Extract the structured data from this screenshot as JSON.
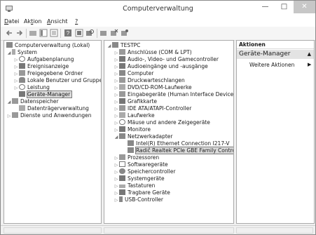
{
  "window": {
    "title": "Computerverwaltung",
    "min_glyph": "—",
    "max_glyph": "□",
    "close_glyph": "✕"
  },
  "menu": {
    "datei": "atei",
    "datei_key": "D",
    "aktion_pre": "Ak",
    "aktion_key": "t",
    "aktion_post": "ion",
    "ansicht_pre": "",
    "ansicht_key": "A",
    "ansicht_post": "nsicht",
    "help_key": "?"
  },
  "left_tree": {
    "root": "Computerverwaltung (Lokal)",
    "system": "System",
    "aufgaben": "Aufgabenplanung",
    "ereignis": "Ereignisanzeige",
    "freigabe": "Freigegebene Ordner",
    "benutzer": "Lokale Benutzer und Gruppen",
    "leistung": "Leistung",
    "geraete": "Geräte-Manager",
    "speicher": "Datenspeicher",
    "datentraeger": "Datenträgerverwaltung",
    "dienste": "Dienste und Anwendungen"
  },
  "device_tree": {
    "root": "TESTPC",
    "items": [
      "Anschlüsse (COM & LPT)",
      "Audio-, Video- und Gamecontroller",
      "Audioeingänge und -ausgänge",
      "Computer",
      "Druckwarteschlangen",
      "DVD/CD-ROM-Laufwerke",
      "Eingabegeräte (Human Interface Devices)",
      "Grafikkarte",
      "IDE ATA/ATAPI-Controller",
      "Laufwerke",
      "Mäuse und andere Zeigegeräte",
      "Monitore",
      "Netzwerkadapter",
      "Intel(R) Ethernet Connection I217-V",
      "Radič Realtek PCIe GBE Family Controller",
      "Prozessoren",
      "Softwaregeräte",
      "Speichercontroller",
      "Systemgeräte",
      "Tastaturen",
      "Tragbare Geräte",
      "USB-Controller"
    ]
  },
  "actions": {
    "header": "Aktionen",
    "section": "Geräte-Manager",
    "more": "Weitere Aktionen",
    "more_arrow": "▶",
    "caret": "▲"
  },
  "arrows": {
    "collapsed": "▷",
    "expanded": "◢"
  }
}
